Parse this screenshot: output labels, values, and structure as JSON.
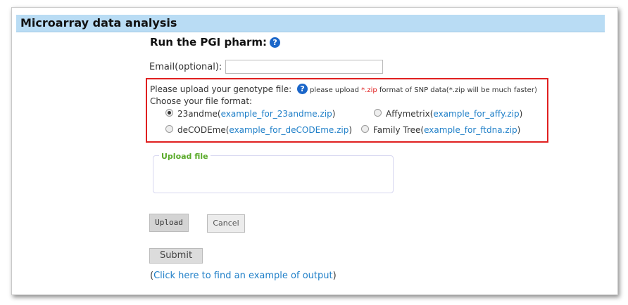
{
  "header": {
    "title": "Microarray data analysis"
  },
  "run": {
    "title": "Run the PGI pharm:"
  },
  "email": {
    "label": "Email(optional):",
    "value": ""
  },
  "upload": {
    "prompt": "Please upload your genotype file:",
    "hint_prefix": "please upload ",
    "hint_ext": "*.zip",
    "hint_suffix": " format of SNP data(*.zip will be much faster)",
    "choose_label": "Choose your file format:",
    "options": [
      {
        "label": "23andme(",
        "link": "example_for_23andme.zip",
        "tail": ")",
        "checked": true
      },
      {
        "label": "Affymetrix(",
        "link": "example_for_affy.zip",
        "tail": ")",
        "checked": false
      },
      {
        "label": "deCODEme(",
        "link": "example_for_deCODEme.zip",
        "tail": ")",
        "checked": false
      },
      {
        "label": "Family Tree(",
        "link": "example_for_ftdna.zip",
        "tail": ")",
        "checked": false
      }
    ]
  },
  "fileset": {
    "legend": "Upload file"
  },
  "buttons": {
    "upload": "Upload",
    "cancel": "Cancel",
    "submit": "Submit"
  },
  "output": {
    "open": "(",
    "link": "Click here to find an example of output",
    "close": ")"
  },
  "colors": {
    "header_bg": "#b9dcf4",
    "highlight_border": "#e02020",
    "link": "#1f7fc8",
    "legend": "#5aaa2a"
  },
  "icons": {
    "help": "question-circle-icon"
  }
}
